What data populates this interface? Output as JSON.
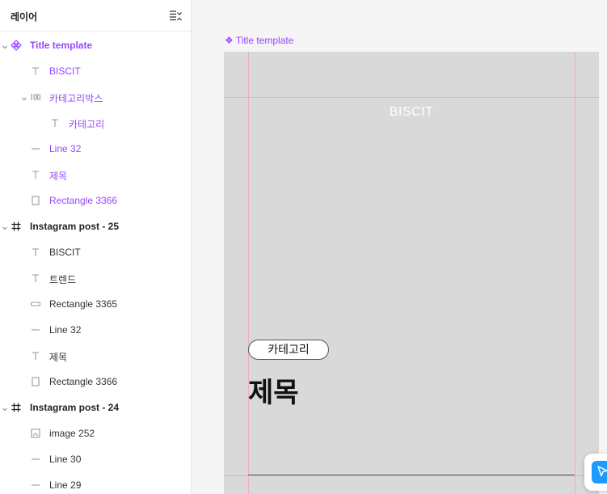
{
  "panel": {
    "title": "레이어"
  },
  "layers": [
    {
      "label": "Title template",
      "kind": "component-head",
      "icon": "component-icon",
      "chevron": "open"
    },
    {
      "label": "BISCIT",
      "kind": "comp",
      "icon": "text-icon"
    },
    {
      "label": "카테고리박스",
      "kind": "comp",
      "icon": "auto-layout-icon",
      "chevron": "open"
    },
    {
      "label": "카테고리",
      "kind": "comp",
      "icon": "text-icon"
    },
    {
      "label": "Line 32",
      "kind": "comp",
      "icon": "line-icon"
    },
    {
      "label": "제목",
      "kind": "comp",
      "icon": "text-icon"
    },
    {
      "label": "Rectangle 3366",
      "kind": "comp",
      "icon": "rectangle-icon"
    },
    {
      "label": "Instagram post - 25",
      "kind": "frame",
      "icon": "frame-icon",
      "chevron": "open"
    },
    {
      "label": "BISCIT",
      "kind": "plain",
      "icon": "text-icon"
    },
    {
      "label": "트렌드",
      "kind": "plain",
      "icon": "text-icon"
    },
    {
      "label": "Rectangle 3365",
      "kind": "plain",
      "icon": "pill-rectangle-icon"
    },
    {
      "label": "Line 32",
      "kind": "plain",
      "icon": "line-icon"
    },
    {
      "label": "제목",
      "kind": "plain",
      "icon": "text-icon"
    },
    {
      "label": "Rectangle 3366",
      "kind": "plain",
      "icon": "rectangle-icon"
    },
    {
      "label": "Instagram post - 24",
      "kind": "frame",
      "icon": "frame-icon",
      "chevron": "open"
    },
    {
      "label": "image 252",
      "kind": "plain",
      "icon": "image-icon"
    },
    {
      "label": "Line 30",
      "kind": "plain",
      "icon": "line-icon"
    },
    {
      "label": "Line 29",
      "kind": "plain",
      "icon": "line-icon"
    }
  ],
  "canvas": {
    "frame_label": "Title template",
    "brand": "BISCIT",
    "category": "카테고리",
    "title": "제목"
  },
  "colors": {
    "component": "#9747ff",
    "artboard": "#d9d9d9",
    "guide": "#f3a3b5",
    "fab": "#1e9bff"
  }
}
